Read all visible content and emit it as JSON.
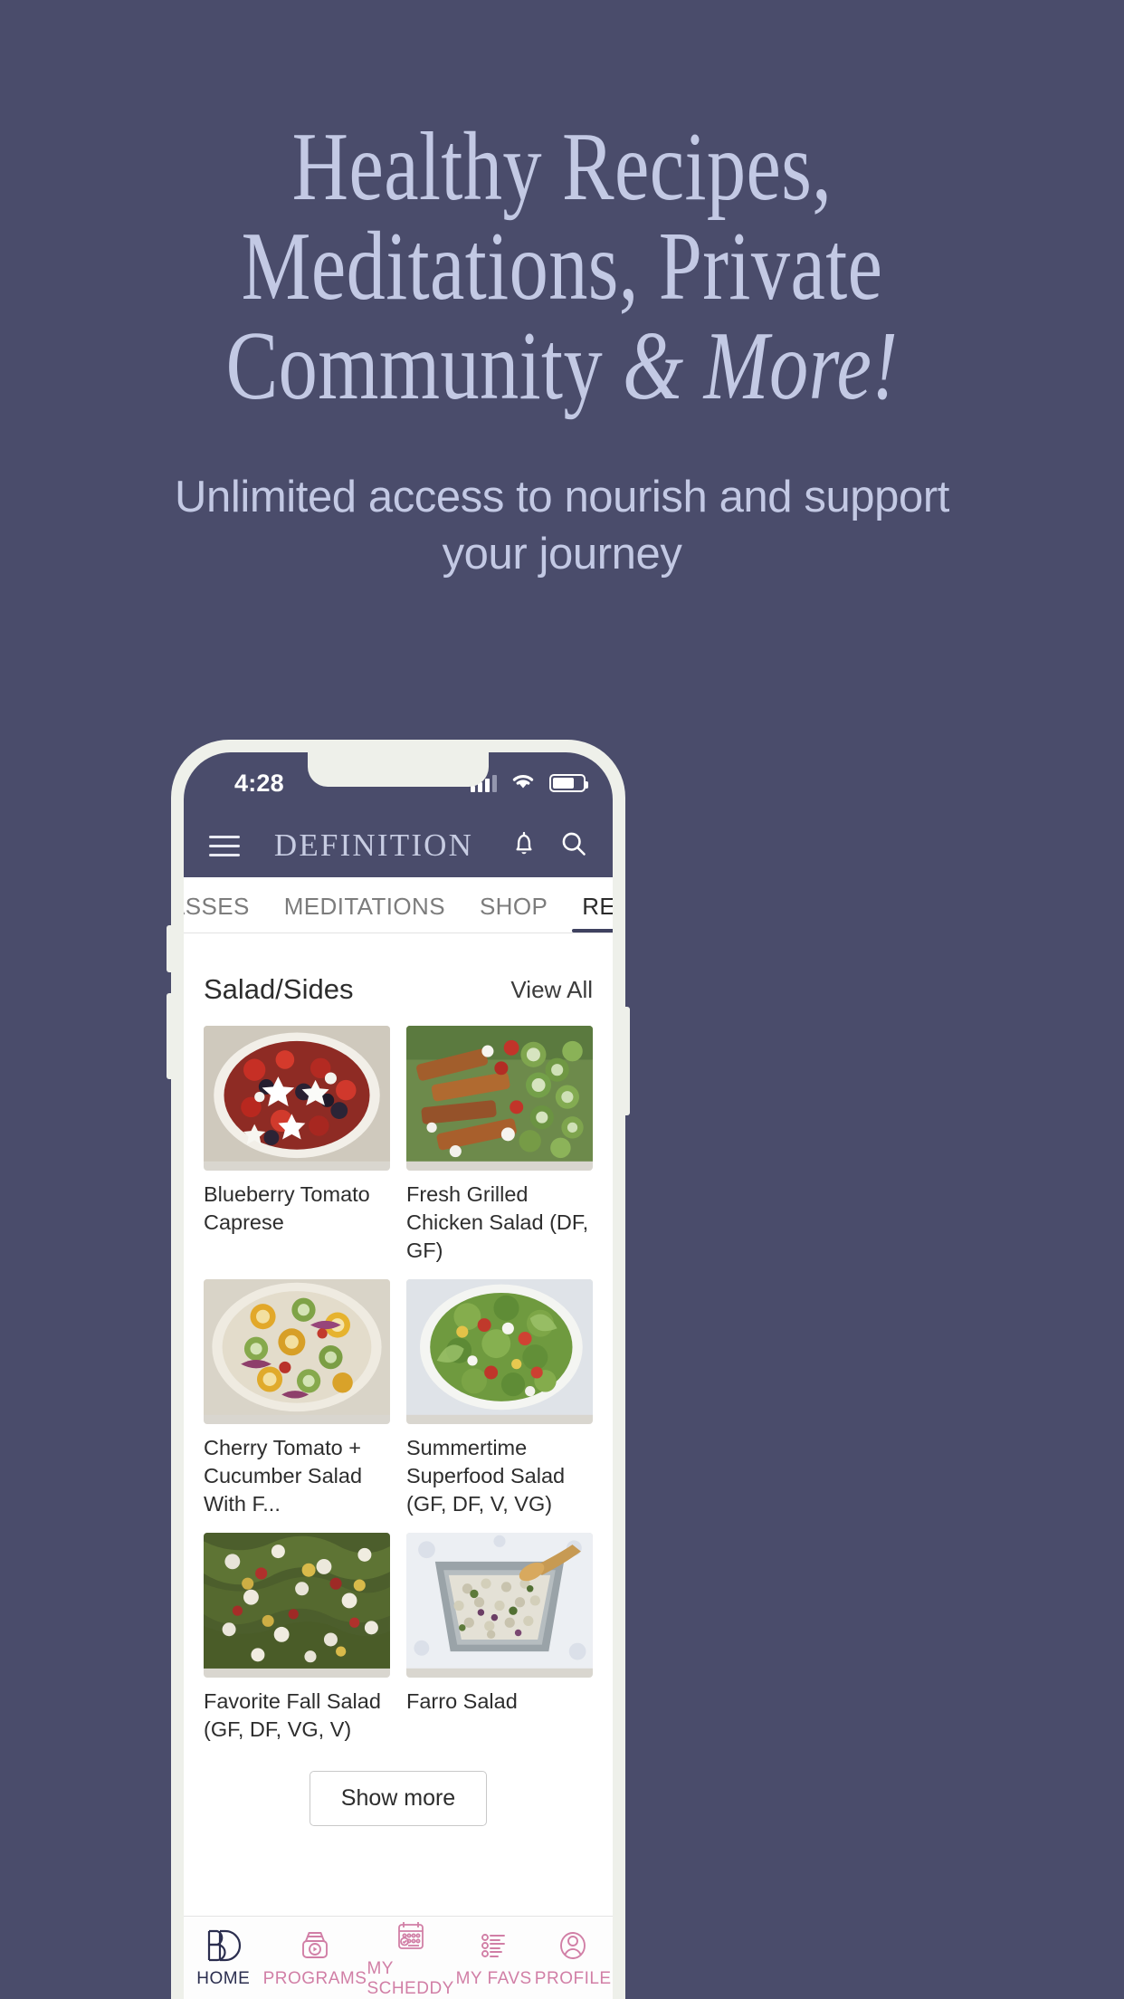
{
  "promo": {
    "headline_line1": "Healthy Recipes,",
    "headline_line2": "Meditations, Private",
    "headline_line3a": "Community ",
    "headline_line3b": "& More!",
    "subtitle": "Unlimited access to nourish and support your journey",
    "background_color": "#4a4c6b",
    "text_color": "#c3c9e4"
  },
  "phone": {
    "statusbar": {
      "time": "4:28",
      "signal_icon": "signal-bars-icon",
      "wifi_icon": "wifi-icon",
      "battery_icon": "battery-icon"
    },
    "appbar": {
      "menu_icon": "hamburger-menu-icon",
      "brand": "DEFINITION",
      "bell_icon": "notification-bell-icon",
      "search_icon": "search-icon"
    },
    "tabs": [
      {
        "label": "ASSES",
        "active": false
      },
      {
        "label": "MEDITATIONS",
        "active": false
      },
      {
        "label": "SHOP",
        "active": false
      },
      {
        "label": "RECIPES",
        "active": true
      }
    ],
    "section": {
      "title": "Salad/Sides",
      "view_all": "View All"
    },
    "recipes": [
      {
        "title": "Blueberry Tomato Caprese"
      },
      {
        "title": "Fresh Grilled Chicken Salad (DF, GF)"
      },
      {
        "title": "Cherry Tomato + Cucumber Salad With F..."
      },
      {
        "title": "Summertime Superfood Salad (GF, DF, V, VG)"
      },
      {
        "title": "Favorite Fall Salad (GF, DF, VG, V)"
      },
      {
        "title": "Farro Salad"
      }
    ],
    "show_more": "Show more",
    "bottomnav": [
      {
        "label": "HOME",
        "icon": "bd-monogram-logo-icon",
        "active": true
      },
      {
        "label": "PROGRAMS",
        "icon": "video-programs-icon",
        "active": false
      },
      {
        "label": "MY SCHEDDY",
        "icon": "calendar-icon",
        "active": false
      },
      {
        "label": "MY FAVS",
        "icon": "list-favorites-icon",
        "active": false
      },
      {
        "label": "PROFILE",
        "icon": "user-profile-icon",
        "active": false
      }
    ],
    "accent_color": "#d17fa6",
    "active_color": "#2b2e4f"
  }
}
